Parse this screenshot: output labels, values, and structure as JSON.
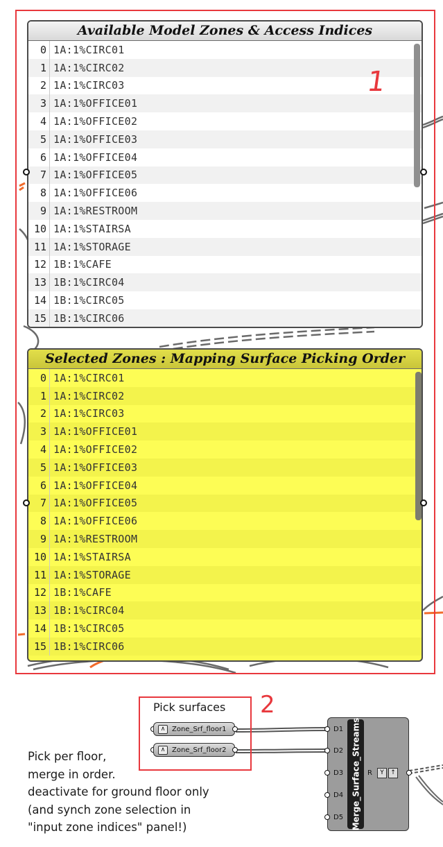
{
  "panel_available": {
    "title": "Available Model Zones & Access Indices",
    "rows": [
      {
        "index": "0",
        "value": "1A:1%CIRC01"
      },
      {
        "index": "1",
        "value": "1A:1%CIRC02"
      },
      {
        "index": "2",
        "value": "1A:1%CIRC03"
      },
      {
        "index": "3",
        "value": "1A:1%OFFICE01"
      },
      {
        "index": "4",
        "value": "1A:1%OFFICE02"
      },
      {
        "index": "5",
        "value": "1A:1%OFFICE03"
      },
      {
        "index": "6",
        "value": "1A:1%OFFICE04"
      },
      {
        "index": "7",
        "value": "1A:1%OFFICE05"
      },
      {
        "index": "8",
        "value": "1A:1%OFFICE06"
      },
      {
        "index": "9",
        "value": "1A:1%RESTROOM"
      },
      {
        "index": "10",
        "value": "1A:1%STAIRSA"
      },
      {
        "index": "11",
        "value": "1A:1%STORAGE"
      },
      {
        "index": "12",
        "value": "1B:1%CAFE"
      },
      {
        "index": "13",
        "value": "1B:1%CIRC04"
      },
      {
        "index": "14",
        "value": "1B:1%CIRC05"
      },
      {
        "index": "15",
        "value": "1B:1%CIRC06"
      }
    ]
  },
  "panel_selected": {
    "title": "Selected Zones : Mapping Surface Picking Order",
    "rows": [
      {
        "index": "0",
        "value": "1A:1%CIRC01"
      },
      {
        "index": "1",
        "value": "1A:1%CIRC02"
      },
      {
        "index": "2",
        "value": "1A:1%CIRC03"
      },
      {
        "index": "3",
        "value": "1A:1%OFFICE01"
      },
      {
        "index": "4",
        "value": "1A:1%OFFICE02"
      },
      {
        "index": "5",
        "value": "1A:1%OFFICE03"
      },
      {
        "index": "6",
        "value": "1A:1%OFFICE04"
      },
      {
        "index": "7",
        "value": "1A:1%OFFICE05"
      },
      {
        "index": "8",
        "value": "1A:1%OFFICE06"
      },
      {
        "index": "9",
        "value": "1A:1%RESTROOM"
      },
      {
        "index": "10",
        "value": "1A:1%STAIRSA"
      },
      {
        "index": "11",
        "value": "1A:1%STORAGE"
      },
      {
        "index": "12",
        "value": "1B:1%CAFE"
      },
      {
        "index": "13",
        "value": "1B:1%CIRC04"
      },
      {
        "index": "14",
        "value": "1B:1%CIRC05"
      },
      {
        "index": "15",
        "value": "1B:1%CIRC06"
      }
    ]
  },
  "annotations": {
    "marker_1": "1",
    "marker_2": "2",
    "pick_surfaces": "Pick surfaces"
  },
  "params": {
    "floor1": "Zone_Srf_floor1",
    "floor2": "Zone_Srf_floor2"
  },
  "component": {
    "name": "Merge_Surface_Streams",
    "inputs": [
      "D1",
      "D2",
      "D3",
      "D4",
      "D5"
    ],
    "output": "R",
    "output_icons": [
      "Y",
      "↑"
    ]
  },
  "note": {
    "lines": [
      "Pick per floor,",
      "merge in order.",
      "deactivate for ground floor only",
      "(and synch zone selection in",
      "\"input zone indices\" panel!)"
    ]
  },
  "colors": {
    "annotation_red": "#e8383d",
    "selected_panel_yellow": "#fafa50",
    "selected_title_bar": "#d6d240",
    "wire_orange": "#f26b2b"
  }
}
